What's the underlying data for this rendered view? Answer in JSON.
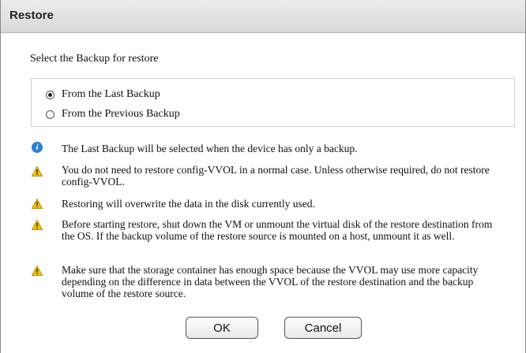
{
  "dialog": {
    "title": "Restore",
    "prompt": "Select the Backup for restore",
    "options": [
      {
        "label": "From the Last Backup",
        "selected": true
      },
      {
        "label": "From the Previous Backup",
        "selected": false
      }
    ],
    "messages": [
      {
        "icon": "info-icon",
        "text": "The Last Backup will be selected when the device has only a backup."
      },
      {
        "icon": "warning-icon",
        "text": "You do not need to restore config-VVOL in a normal case. Unless otherwise required, do not restore config-VVOL."
      },
      {
        "icon": "warning-icon",
        "text": "Restoring will overwrite the data in the disk currently used."
      },
      {
        "icon": "warning-icon",
        "text": "Before starting restore, shut down the VM or unmount the virtual disk of the restore destination from the OS. If the backup volume of the restore source is mounted on a host, unmount it as well."
      },
      {
        "icon": "warning-icon",
        "text": "Make sure that the storage container has enough space because the VVOL may use more capacity depending on the difference in data between the VVOL of the restore destination and the backup volume of the restore source."
      }
    ],
    "ok_label": "OK",
    "cancel_label": "Cancel"
  },
  "colors": {
    "info": "#2a7fd4",
    "warning": "#f2c318"
  }
}
